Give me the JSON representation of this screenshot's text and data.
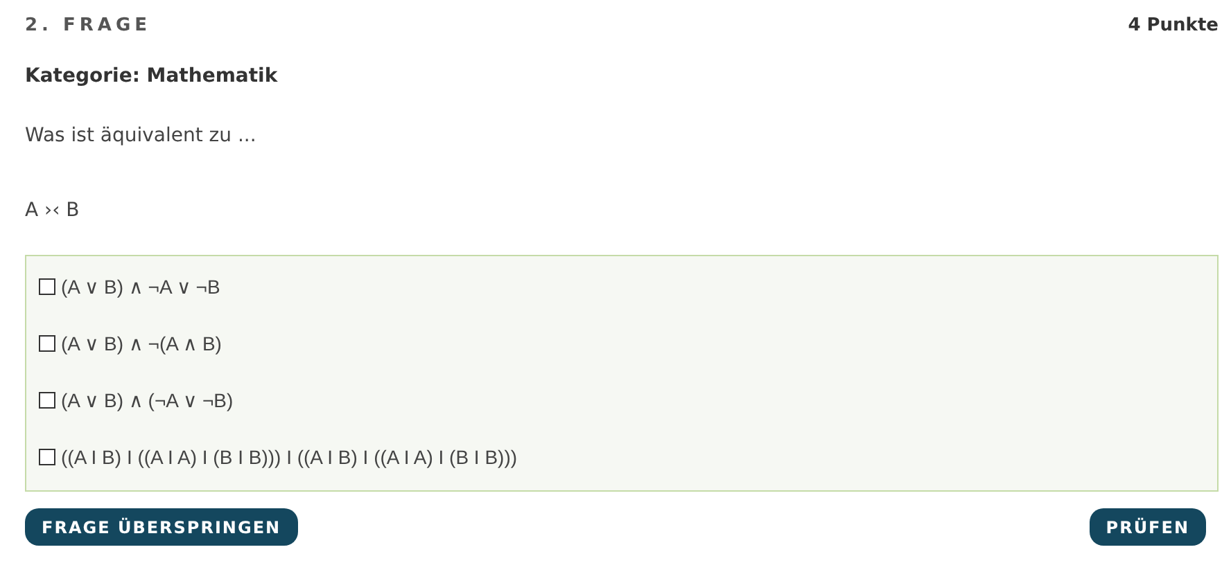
{
  "question": {
    "number": "2. FRAGE",
    "points": "4 Punkte",
    "category": "Kategorie: Mathematik",
    "prompt": "Was ist äquivalent zu ...",
    "formula": "A ›‹ B"
  },
  "options": [
    {
      "label": "(A ∨ B) ∧ ¬A ∨ ¬B",
      "checked": false
    },
    {
      "label": "(A ∨ B) ∧ ¬(A ∧ B)",
      "checked": false
    },
    {
      "label": "(A ∨ B) ∧ (¬A ∨ ¬B)",
      "checked": false
    },
    {
      "label": "((A I B) I ((A I A) I (B I B))) I ((A I B) I ((A I A) I (B I B)))",
      "checked": false
    }
  ],
  "buttons": [
    {
      "label": "FRAGE ÜBERSPRINGEN"
    },
    {
      "label": "PRÜFEN"
    }
  ]
}
